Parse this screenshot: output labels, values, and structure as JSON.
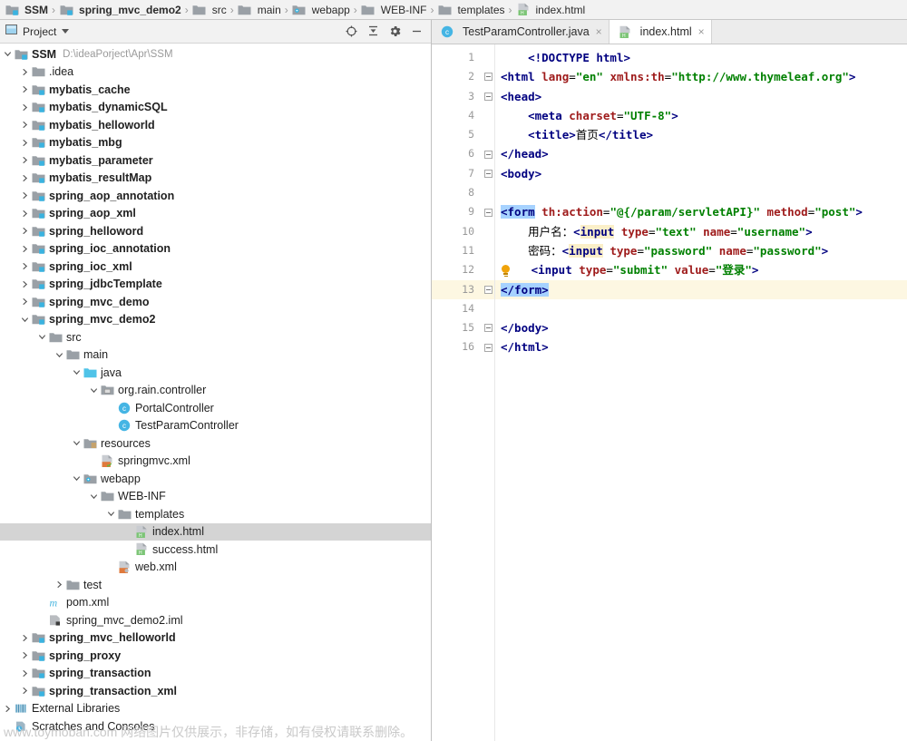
{
  "breadcrumb": {
    "items": [
      {
        "label": "SSM",
        "icon": "module-icon",
        "bold": true
      },
      {
        "label": "spring_mvc_demo2",
        "icon": "module-icon",
        "bold": true
      },
      {
        "label": "src",
        "icon": "folder-icon",
        "bold": false
      },
      {
        "label": "main",
        "icon": "folder-icon",
        "bold": false
      },
      {
        "label": "webapp",
        "icon": "webapp-folder-icon",
        "bold": false
      },
      {
        "label": "WEB-INF",
        "icon": "folder-icon",
        "bold": false
      },
      {
        "label": "templates",
        "icon": "folder-icon",
        "bold": false
      },
      {
        "label": "index.html",
        "icon": "html-file-icon",
        "bold": false
      }
    ],
    "separator": "›"
  },
  "project_panel": {
    "title": "Project",
    "title_icon": "project-view-icon",
    "dropdown_icon": "chevron-down-icon",
    "toolbar": [
      {
        "name": "locate-file-icon",
        "label": "Select Opened File"
      },
      {
        "name": "collapse-all-icon",
        "label": "Collapse All"
      },
      {
        "name": "gear-icon",
        "label": "Settings"
      },
      {
        "name": "minimize-icon",
        "label": "Hide"
      }
    ],
    "tree": [
      {
        "indent": 0,
        "arrow": "down",
        "icon": "module-icon",
        "label": "SSM",
        "bold": true,
        "path": "D:\\ideaPorject\\Apr\\SSM",
        "selected": false
      },
      {
        "indent": 1,
        "arrow": "right",
        "icon": "folder-icon",
        "label": ".idea",
        "bold": false,
        "selected": false
      },
      {
        "indent": 1,
        "arrow": "right",
        "icon": "module-icon",
        "label": "mybatis_cache",
        "bold": true,
        "selected": false
      },
      {
        "indent": 1,
        "arrow": "right",
        "icon": "module-icon",
        "label": "mybatis_dynamicSQL",
        "bold": true,
        "selected": false
      },
      {
        "indent": 1,
        "arrow": "right",
        "icon": "module-icon",
        "label": "mybatis_helloworld",
        "bold": true,
        "selected": false
      },
      {
        "indent": 1,
        "arrow": "right",
        "icon": "module-icon",
        "label": "mybatis_mbg",
        "bold": true,
        "selected": false
      },
      {
        "indent": 1,
        "arrow": "right",
        "icon": "module-icon",
        "label": "mybatis_parameter",
        "bold": true,
        "selected": false
      },
      {
        "indent": 1,
        "arrow": "right",
        "icon": "module-icon",
        "label": "mybatis_resultMap",
        "bold": true,
        "selected": false
      },
      {
        "indent": 1,
        "arrow": "right",
        "icon": "module-icon",
        "label": "spring_aop_annotation",
        "bold": true,
        "selected": false
      },
      {
        "indent": 1,
        "arrow": "right",
        "icon": "module-icon",
        "label": "spring_aop_xml",
        "bold": true,
        "selected": false
      },
      {
        "indent": 1,
        "arrow": "right",
        "icon": "module-icon",
        "label": "spring_helloword",
        "bold": true,
        "selected": false
      },
      {
        "indent": 1,
        "arrow": "right",
        "icon": "module-icon",
        "label": "spring_ioc_annotation",
        "bold": true,
        "selected": false
      },
      {
        "indent": 1,
        "arrow": "right",
        "icon": "module-icon",
        "label": "spring_ioc_xml",
        "bold": true,
        "selected": false
      },
      {
        "indent": 1,
        "arrow": "right",
        "icon": "module-icon",
        "label": "spring_jdbcTemplate",
        "bold": true,
        "selected": false
      },
      {
        "indent": 1,
        "arrow": "right",
        "icon": "module-icon",
        "label": "spring_mvc_demo",
        "bold": true,
        "selected": false
      },
      {
        "indent": 1,
        "arrow": "down",
        "icon": "module-icon",
        "label": "spring_mvc_demo2",
        "bold": true,
        "selected": false
      },
      {
        "indent": 2,
        "arrow": "down",
        "icon": "folder-icon",
        "label": "src",
        "bold": false,
        "selected": false
      },
      {
        "indent": 3,
        "arrow": "down",
        "icon": "folder-icon",
        "label": "main",
        "bold": false,
        "selected": false
      },
      {
        "indent": 4,
        "arrow": "down",
        "icon": "source-root-icon",
        "label": "java",
        "bold": false,
        "selected": false
      },
      {
        "indent": 5,
        "arrow": "down",
        "icon": "package-icon",
        "label": "org.rain.controller",
        "bold": false,
        "selected": false
      },
      {
        "indent": 6,
        "arrow": "none",
        "icon": "java-class-icon",
        "label": "PortalController",
        "bold": false,
        "selected": false
      },
      {
        "indent": 6,
        "arrow": "none",
        "icon": "java-class-icon",
        "label": "TestParamController",
        "bold": false,
        "selected": false
      },
      {
        "indent": 4,
        "arrow": "down",
        "icon": "resources-root-icon",
        "label": "resources",
        "bold": false,
        "selected": false
      },
      {
        "indent": 5,
        "arrow": "none",
        "icon": "spring-xml-icon",
        "label": "springmvc.xml",
        "bold": false,
        "selected": false
      },
      {
        "indent": 4,
        "arrow": "down",
        "icon": "webapp-folder-icon",
        "label": "webapp",
        "bold": false,
        "selected": false
      },
      {
        "indent": 5,
        "arrow": "down",
        "icon": "folder-icon",
        "label": "WEB-INF",
        "bold": false,
        "selected": false
      },
      {
        "indent": 6,
        "arrow": "down",
        "icon": "folder-icon",
        "label": "templates",
        "bold": false,
        "selected": false
      },
      {
        "indent": 7,
        "arrow": "none",
        "icon": "html-file-icon",
        "label": "index.html",
        "bold": false,
        "selected": true
      },
      {
        "indent": 7,
        "arrow": "none",
        "icon": "html-file-icon",
        "label": "success.html",
        "bold": false,
        "selected": false
      },
      {
        "indent": 6,
        "arrow": "none",
        "icon": "xml-file-icon",
        "label": "web.xml",
        "bold": false,
        "selected": false
      },
      {
        "indent": 3,
        "arrow": "right",
        "icon": "folder-icon",
        "label": "test",
        "bold": false,
        "selected": false
      },
      {
        "indent": 2,
        "arrow": "none",
        "icon": "maven-icon",
        "label": "pom.xml",
        "bold": false,
        "selected": false
      },
      {
        "indent": 2,
        "arrow": "none",
        "icon": "iml-icon",
        "label": "spring_mvc_demo2.iml",
        "bold": false,
        "selected": false
      },
      {
        "indent": 1,
        "arrow": "right",
        "icon": "module-icon",
        "label": "spring_mvc_helloworld",
        "bold": true,
        "selected": false
      },
      {
        "indent": 1,
        "arrow": "right",
        "icon": "module-icon",
        "label": "spring_proxy",
        "bold": true,
        "selected": false
      },
      {
        "indent": 1,
        "arrow": "right",
        "icon": "module-icon",
        "label": "spring_transaction",
        "bold": true,
        "selected": false
      },
      {
        "indent": 1,
        "arrow": "right",
        "icon": "module-icon",
        "label": "spring_transaction_xml",
        "bold": true,
        "selected": false
      },
      {
        "indent": 0,
        "arrow": "right",
        "icon": "external-libraries-icon",
        "label": "External Libraries",
        "bold": false,
        "selected": false
      },
      {
        "indent": 0,
        "arrow": "none",
        "icon": "scratches-icon",
        "label": "Scratches and Consoles",
        "bold": false,
        "selected": false
      }
    ]
  },
  "watermark": "www.toymoban.com 网络图片仅供展示，非存储，如有侵权请联系删除。",
  "editor": {
    "tabs": [
      {
        "label": "TestParamController.java",
        "icon": "java-class-icon",
        "active": false,
        "close": "×"
      },
      {
        "label": "index.html",
        "icon": "html-file-icon",
        "active": true,
        "close": "×"
      }
    ],
    "current_line": 13,
    "line_numbers": [
      1,
      2,
      3,
      4,
      5,
      6,
      7,
      8,
      9,
      10,
      11,
      12,
      13,
      14,
      15,
      16
    ],
    "code_lines": [
      {
        "n": 1,
        "fold": false,
        "bulb": false,
        "hl": false,
        "tokens": [
          {
            "t": "    ",
            "c": "pl"
          },
          {
            "t": "<!DOCTYPE html>",
            "c": "doct"
          }
        ]
      },
      {
        "n": 2,
        "fold": true,
        "bulb": false,
        "hl": false,
        "tokens": [
          {
            "t": "<html",
            "c": "tg"
          },
          {
            "t": " ",
            "c": "pl"
          },
          {
            "t": "lang",
            "c": "at"
          },
          {
            "t": "=",
            "c": "pl"
          },
          {
            "t": "\"en\"",
            "c": "vl"
          },
          {
            "t": " ",
            "c": "pl"
          },
          {
            "t": "xmlns:th",
            "c": "at"
          },
          {
            "t": "=",
            "c": "pl"
          },
          {
            "t": "\"http://www.thymeleaf.org\"",
            "c": "vl"
          },
          {
            "t": ">",
            "c": "tg"
          }
        ]
      },
      {
        "n": 3,
        "fold": true,
        "bulb": false,
        "hl": false,
        "tokens": [
          {
            "t": "<head>",
            "c": "tg"
          }
        ]
      },
      {
        "n": 4,
        "fold": false,
        "bulb": false,
        "hl": false,
        "tokens": [
          {
            "t": "    ",
            "c": "pl"
          },
          {
            "t": "<meta",
            "c": "tg"
          },
          {
            "t": " ",
            "c": "pl"
          },
          {
            "t": "charset",
            "c": "at"
          },
          {
            "t": "=",
            "c": "pl"
          },
          {
            "t": "\"UTF-8\"",
            "c": "vl"
          },
          {
            "t": ">",
            "c": "tg"
          }
        ]
      },
      {
        "n": 5,
        "fold": false,
        "bulb": false,
        "hl": false,
        "tokens": [
          {
            "t": "    ",
            "c": "pl"
          },
          {
            "t": "<title>",
            "c": "tg"
          },
          {
            "t": "首页",
            "c": "pl"
          },
          {
            "t": "</title>",
            "c": "tg"
          }
        ]
      },
      {
        "n": 6,
        "fold": true,
        "bulb": false,
        "hl": false,
        "tokens": [
          {
            "t": "</head>",
            "c": "tg"
          }
        ]
      },
      {
        "n": 7,
        "fold": true,
        "bulb": false,
        "hl": false,
        "tokens": [
          {
            "t": "<body>",
            "c": "tg"
          }
        ]
      },
      {
        "n": 8,
        "fold": false,
        "bulb": false,
        "hl": false,
        "tokens": []
      },
      {
        "n": 9,
        "fold": true,
        "bulb": false,
        "hl": false,
        "tokens": [
          {
            "t": "<form",
            "c": "tg sel"
          },
          {
            "t": " ",
            "c": "pl"
          },
          {
            "t": "th:action",
            "c": "at"
          },
          {
            "t": "=",
            "c": "pl"
          },
          {
            "t": "\"@{/param/servletAPI}\"",
            "c": "vl"
          },
          {
            "t": " ",
            "c": "pl"
          },
          {
            "t": "method",
            "c": "at"
          },
          {
            "t": "=",
            "c": "pl"
          },
          {
            "t": "\"post\"",
            "c": "vl"
          },
          {
            "t": ">",
            "c": "tg"
          }
        ]
      },
      {
        "n": 10,
        "fold": false,
        "bulb": false,
        "hl": false,
        "tokens": [
          {
            "t": "    ",
            "c": "pl"
          },
          {
            "t": "用户名：",
            "c": "pl"
          },
          {
            "t": "<",
            "c": "tg"
          },
          {
            "t": "input",
            "c": "tg mark"
          },
          {
            "t": " ",
            "c": "pl"
          },
          {
            "t": "type",
            "c": "at"
          },
          {
            "t": "=",
            "c": "pl"
          },
          {
            "t": "\"text\"",
            "c": "vl"
          },
          {
            "t": " ",
            "c": "pl"
          },
          {
            "t": "name",
            "c": "at"
          },
          {
            "t": "=",
            "c": "pl"
          },
          {
            "t": "\"username\"",
            "c": "vl"
          },
          {
            "t": ">",
            "c": "tg"
          }
        ]
      },
      {
        "n": 11,
        "fold": false,
        "bulb": false,
        "hl": false,
        "tokens": [
          {
            "t": "    ",
            "c": "pl"
          },
          {
            "t": "密码：",
            "c": "pl"
          },
          {
            "t": "<",
            "c": "tg"
          },
          {
            "t": "input",
            "c": "tg mark"
          },
          {
            "t": " ",
            "c": "pl"
          },
          {
            "t": "type",
            "c": "at"
          },
          {
            "t": "=",
            "c": "pl"
          },
          {
            "t": "\"password\"",
            "c": "vl"
          },
          {
            "t": " ",
            "c": "pl"
          },
          {
            "t": "name",
            "c": "at"
          },
          {
            "t": "=",
            "c": "pl"
          },
          {
            "t": "\"password\"",
            "c": "vl"
          },
          {
            "t": ">",
            "c": "tg"
          }
        ]
      },
      {
        "n": 12,
        "fold": false,
        "bulb": true,
        "hl": false,
        "tokens": [
          {
            "t": "   ",
            "c": "pl"
          },
          {
            "t": "<input",
            "c": "tg"
          },
          {
            "t": " ",
            "c": "pl"
          },
          {
            "t": "type",
            "c": "at"
          },
          {
            "t": "=",
            "c": "pl"
          },
          {
            "t": "\"submit\"",
            "c": "vl"
          },
          {
            "t": " ",
            "c": "pl"
          },
          {
            "t": "value",
            "c": "at"
          },
          {
            "t": "=",
            "c": "pl"
          },
          {
            "t": "\"登录\"",
            "c": "vl"
          },
          {
            "t": ">",
            "c": "tg"
          }
        ]
      },
      {
        "n": 13,
        "fold": true,
        "bulb": false,
        "hl": true,
        "tokens": [
          {
            "t": "</form>",
            "c": "tg sel"
          }
        ]
      },
      {
        "n": 14,
        "fold": false,
        "bulb": false,
        "hl": false,
        "tokens": []
      },
      {
        "n": 15,
        "fold": true,
        "bulb": false,
        "hl": false,
        "tokens": [
          {
            "t": "</body>",
            "c": "tg"
          }
        ]
      },
      {
        "n": 16,
        "fold": true,
        "bulb": false,
        "hl": false,
        "tokens": [
          {
            "t": "</html>",
            "c": "tg"
          }
        ]
      }
    ]
  },
  "colors": {
    "tag": "#000080",
    "attribute": "#9e1a1a",
    "value": "#008000",
    "selection": "#a6d2ff",
    "usage_highlight": "#fbefc8",
    "current_line": "#fdf7e2",
    "tree_selected": "#d4d4d4",
    "chrome": "#f2f2f2"
  }
}
